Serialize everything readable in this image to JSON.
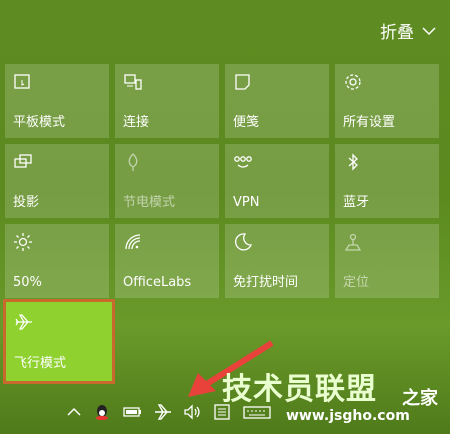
{
  "header": {
    "collapse_label": "折叠"
  },
  "tiles": [
    {
      "label": "平板模式",
      "icon": "tablet-mode-icon"
    },
    {
      "label": "连接",
      "icon": "connect-icon"
    },
    {
      "label": "便笺",
      "icon": "note-icon"
    },
    {
      "label": "所有设置",
      "icon": "gear-icon"
    },
    {
      "label": "投影",
      "icon": "project-icon"
    },
    {
      "label": "节电模式",
      "icon": "battery-saver-icon"
    },
    {
      "label": "VPN",
      "icon": "vpn-icon"
    },
    {
      "label": "蓝牙",
      "icon": "bluetooth-icon"
    },
    {
      "label": "50%",
      "icon": "brightness-icon"
    },
    {
      "label": "OfficeLabs",
      "icon": "wifi-icon"
    },
    {
      "label": "免打扰时间",
      "icon": "moon-icon"
    },
    {
      "label": "定位",
      "icon": "location-icon"
    },
    {
      "label": "飞行模式",
      "icon": "airplane-icon"
    }
  ],
  "watermark": {
    "line1": "技术员联盟",
    "line2": "www.jsgho.com",
    "badge": "之家"
  },
  "colors": {
    "accent_on": "#8fd12f",
    "highlight_border": "#c8692e",
    "arrow": "#e8423b"
  }
}
